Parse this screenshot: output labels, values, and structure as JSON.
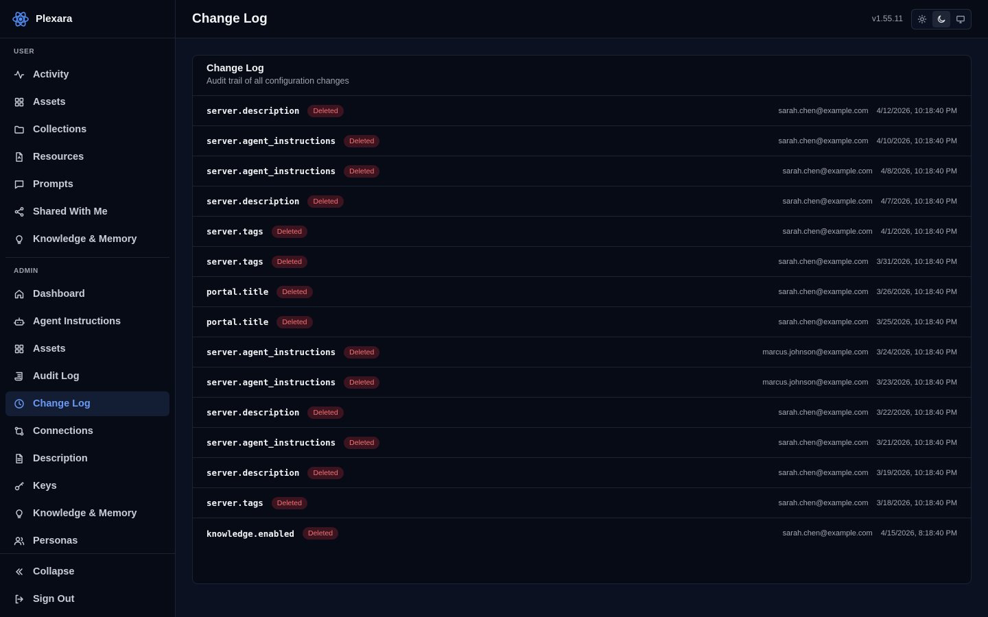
{
  "app": {
    "name": "Plexara"
  },
  "sidebar": {
    "user_label": "USER",
    "user_items": [
      {
        "label": "Activity",
        "icon": "activity-icon"
      },
      {
        "label": "Assets",
        "icon": "grid-icon"
      },
      {
        "label": "Collections",
        "icon": "folder-icon"
      },
      {
        "label": "Resources",
        "icon": "file-icon"
      },
      {
        "label": "Prompts",
        "icon": "message-icon"
      },
      {
        "label": "Shared With Me",
        "icon": "share-icon"
      },
      {
        "label": "Knowledge & Memory",
        "icon": "lightbulb-icon"
      }
    ],
    "admin_label": "ADMIN",
    "admin_items": [
      {
        "label": "Dashboard",
        "icon": "home-icon"
      },
      {
        "label": "Agent Instructions",
        "icon": "bot-icon"
      },
      {
        "label": "Assets",
        "icon": "grid-icon"
      },
      {
        "label": "Audit Log",
        "icon": "scroll-icon"
      },
      {
        "label": "Change Log",
        "icon": "clock-icon"
      },
      {
        "label": "Connections",
        "icon": "connections-icon"
      },
      {
        "label": "Description",
        "icon": "document-icon"
      },
      {
        "label": "Keys",
        "icon": "key-icon"
      },
      {
        "label": "Knowledge & Memory",
        "icon": "lightbulb-icon"
      },
      {
        "label": "Personas",
        "icon": "users-icon"
      }
    ],
    "active_item": "Change Log",
    "collapse_label": "Collapse",
    "signout_label": "Sign Out"
  },
  "header": {
    "title": "Change Log",
    "version": "v1.55.11",
    "theme_options": [
      "light",
      "dark",
      "system"
    ],
    "active_theme": "dark"
  },
  "card": {
    "title": "Change Log",
    "subtitle": "Audit trail of all configuration changes",
    "rows": [
      {
        "key": "server.description",
        "status": "Deleted",
        "user": "sarah.chen@example.com",
        "time": "4/12/2026, 10:18:40 PM"
      },
      {
        "key": "server.agent_instructions",
        "status": "Deleted",
        "user": "sarah.chen@example.com",
        "time": "4/10/2026, 10:18:40 PM"
      },
      {
        "key": "server.agent_instructions",
        "status": "Deleted",
        "user": "sarah.chen@example.com",
        "time": "4/8/2026, 10:18:40 PM"
      },
      {
        "key": "server.description",
        "status": "Deleted",
        "user": "sarah.chen@example.com",
        "time": "4/7/2026, 10:18:40 PM"
      },
      {
        "key": "server.tags",
        "status": "Deleted",
        "user": "sarah.chen@example.com",
        "time": "4/1/2026, 10:18:40 PM"
      },
      {
        "key": "server.tags",
        "status": "Deleted",
        "user": "sarah.chen@example.com",
        "time": "3/31/2026, 10:18:40 PM"
      },
      {
        "key": "portal.title",
        "status": "Deleted",
        "user": "sarah.chen@example.com",
        "time": "3/26/2026, 10:18:40 PM"
      },
      {
        "key": "portal.title",
        "status": "Deleted",
        "user": "sarah.chen@example.com",
        "time": "3/25/2026, 10:18:40 PM"
      },
      {
        "key": "server.agent_instructions",
        "status": "Deleted",
        "user": "marcus.johnson@example.com",
        "time": "3/24/2026, 10:18:40 PM"
      },
      {
        "key": "server.agent_instructions",
        "status": "Deleted",
        "user": "marcus.johnson@example.com",
        "time": "3/23/2026, 10:18:40 PM"
      },
      {
        "key": "server.description",
        "status": "Deleted",
        "user": "sarah.chen@example.com",
        "time": "3/22/2026, 10:18:40 PM"
      },
      {
        "key": "server.agent_instructions",
        "status": "Deleted",
        "user": "sarah.chen@example.com",
        "time": "3/21/2026, 10:18:40 PM"
      },
      {
        "key": "server.description",
        "status": "Deleted",
        "user": "sarah.chen@example.com",
        "time": "3/19/2026, 10:18:40 PM"
      },
      {
        "key": "server.tags",
        "status": "Deleted",
        "user": "sarah.chen@example.com",
        "time": "3/18/2026, 10:18:40 PM"
      },
      {
        "key": "knowledge.enabled",
        "status": "Deleted",
        "user": "sarah.chen@example.com",
        "time": "4/15/2026, 8:18:40 PM"
      }
    ]
  },
  "colors": {
    "accent": "#6b9bf7",
    "badge_text": "#f87171",
    "badge_bg": "#3b1420"
  }
}
